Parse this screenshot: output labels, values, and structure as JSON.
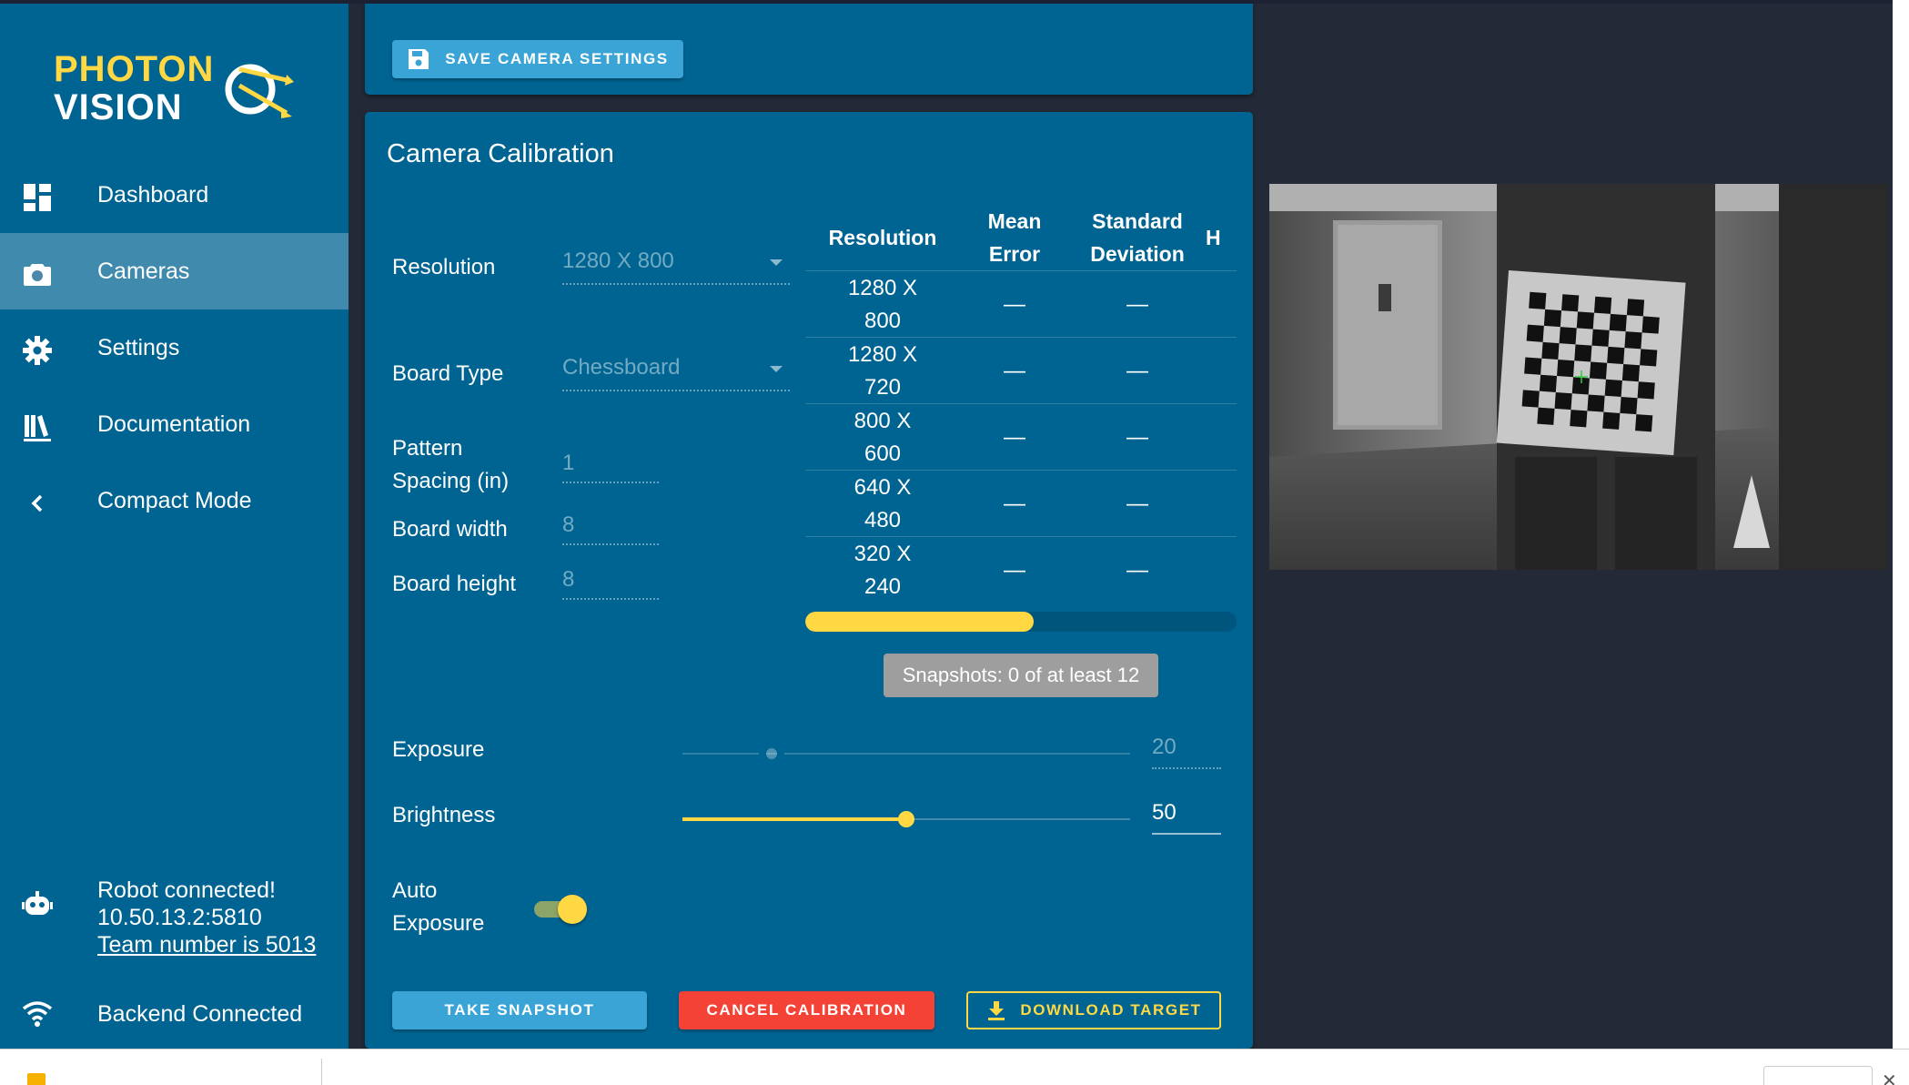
{
  "app": {
    "logo_top": "PHOTON",
    "logo_bottom": "VISION"
  },
  "sidebar": {
    "items": [
      {
        "label": "Dashboard",
        "icon": "dashboard-icon"
      },
      {
        "label": "Cameras",
        "icon": "camera-icon",
        "active": true
      },
      {
        "label": "Settings",
        "icon": "gear-icon"
      },
      {
        "label": "Documentation",
        "icon": "books-icon"
      },
      {
        "label": "Compact Mode",
        "icon": "chevron-left-icon"
      }
    ],
    "robot_status": "Robot connected!",
    "robot_address": "10.50.13.2:5810",
    "team_number": "Team number is 5013",
    "backend_status": "Backend Connected"
  },
  "top_card": {
    "save_label": "Save Camera Settings"
  },
  "calibration": {
    "title": "Camera Calibration",
    "resolution_label": "Resolution",
    "resolution_value": "1280 X 800",
    "board_type_label": "Board Type",
    "board_type_value": "Chessboard",
    "pattern_spacing_label_1": "Pattern",
    "pattern_spacing_label_2": "Spacing (in)",
    "pattern_spacing_value": "1",
    "board_width_label": "Board width",
    "board_width_value": "8",
    "board_height_label": "Board height",
    "board_height_value": "8",
    "table": {
      "headers": {
        "resolution": "Resolution",
        "mean_1": "Mean",
        "mean_2": "Error",
        "std_1": "Standard",
        "std_2": "Deviation",
        "extra": "H"
      },
      "rows": [
        {
          "res_1": "1280 X",
          "res_2": "800",
          "mean": "—",
          "std": "—"
        },
        {
          "res_1": "1280 X",
          "res_2": "720",
          "mean": "—",
          "std": "—"
        },
        {
          "res_1": "800 X",
          "res_2": "600",
          "mean": "—",
          "std": "—"
        },
        {
          "res_1": "640 X",
          "res_2": "480",
          "mean": "—",
          "std": "—"
        },
        {
          "res_1": "320 X",
          "res_2": "240",
          "mean": "—",
          "std": "—"
        }
      ]
    },
    "progress_fraction": 0.53,
    "snapshots_text": "Snapshots: 0 of at least 12",
    "exposure_label": "Exposure",
    "exposure_value": "20",
    "exposure_level": 0.2,
    "brightness_label": "Brightness",
    "brightness_value": "50",
    "brightness_level": 0.5,
    "auto_exposure_label_1": "Auto",
    "auto_exposure_label_2": "Exposure",
    "auto_exposure_on": true,
    "take_snapshot_label": "Take Snapshot",
    "cancel_label": "Cancel Calibration",
    "download_label": "Download Target"
  },
  "colors": {
    "primary": "#006492",
    "accent": "#ffd843",
    "button_blue": "#39a4d5",
    "danger": "#f44336",
    "background": "#232937"
  }
}
